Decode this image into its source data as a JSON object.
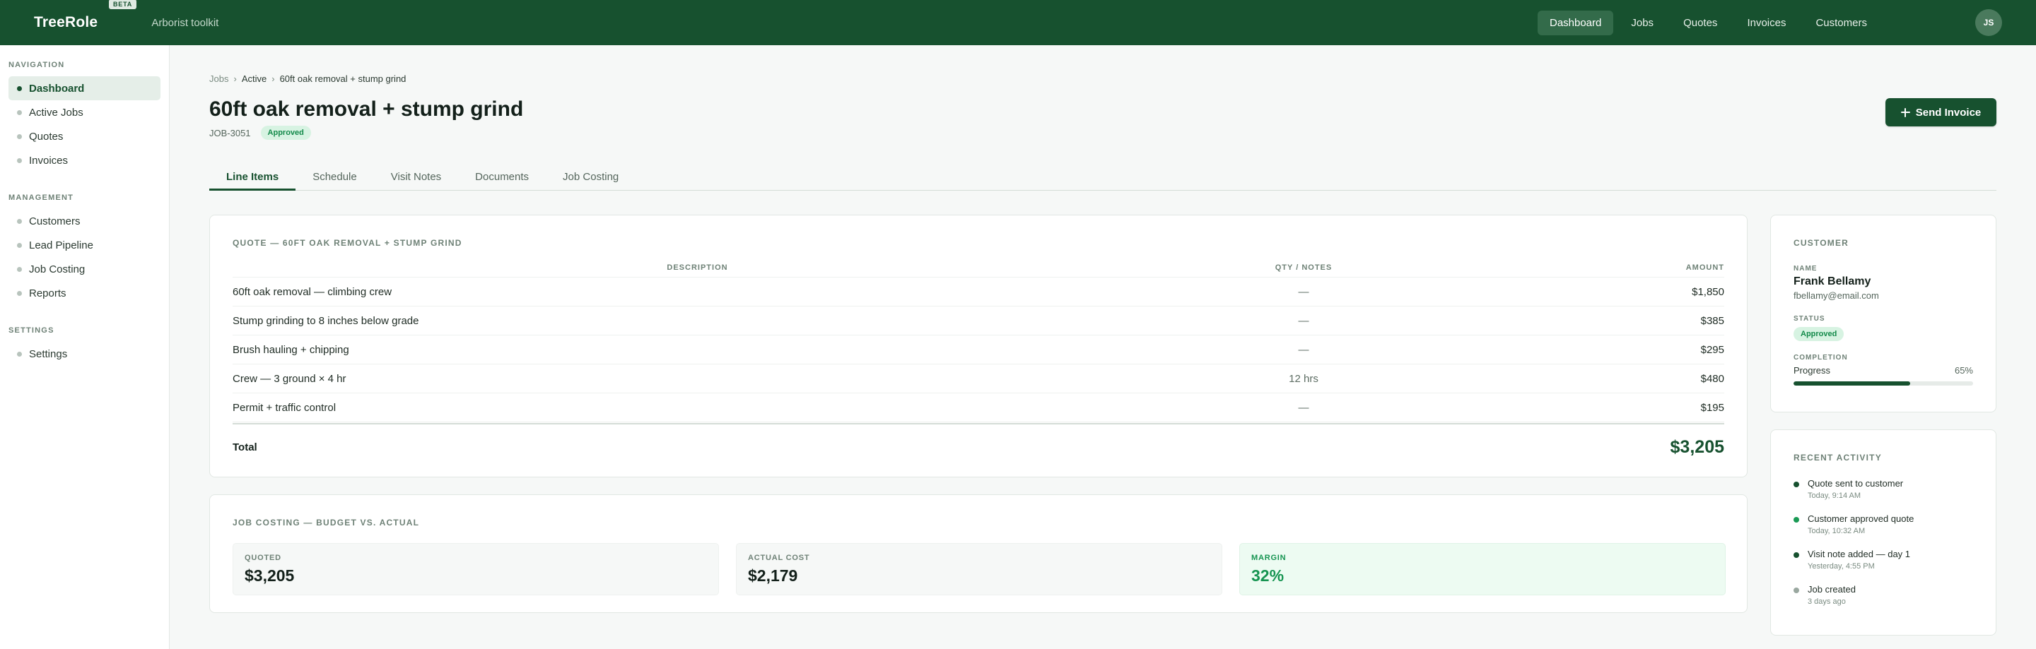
{
  "app": {
    "brand": "TreeRole",
    "beta_label": "BETA",
    "subtitle": "Arborist toolkit",
    "avatar_initials": "JS"
  },
  "topnav": {
    "items": [
      "Dashboard",
      "Jobs",
      "Quotes",
      "Invoices",
      "Customers"
    ],
    "active": "Dashboard"
  },
  "sidebar": {
    "sections": [
      {
        "title": "NAVIGATION",
        "items": [
          "Dashboard",
          "Active Jobs",
          "Quotes",
          "Invoices"
        ]
      },
      {
        "title": "MANAGEMENT",
        "items": [
          "Customers",
          "Lead Pipeline",
          "Job Costing",
          "Reports"
        ]
      },
      {
        "title": "SETTINGS",
        "items": [
          "Settings"
        ]
      }
    ],
    "active": "Dashboard"
  },
  "breadcrumb": [
    "Jobs",
    "Active",
    "60ft oak removal + stump grind"
  ],
  "breadcrumb_sep": "›",
  "job": {
    "title": "60ft oak removal + stump grind",
    "id": "JOB-3051",
    "status": "Approved"
  },
  "actions": {
    "send_invoice_label": "Send Invoice"
  },
  "tabs": {
    "items": [
      "Line Items",
      "Schedule",
      "Visit Notes",
      "Documents",
      "Job Costing"
    ],
    "active": "Line Items"
  },
  "quote": {
    "title": "QUOTE — 60FT OAK REMOVAL + STUMP GRIND",
    "columns": [
      "DESCRIPTION",
      "QTY / NOTES",
      "AMOUNT"
    ],
    "rows": [
      {
        "description": "60ft oak removal — climbing crew",
        "qty": "—",
        "amount": "$1,850"
      },
      {
        "description": "Stump grinding to 8 inches below grade",
        "qty": "—",
        "amount": "$385"
      },
      {
        "description": "Brush hauling + chipping",
        "qty": "—",
        "amount": "$295"
      },
      {
        "description": "Crew — 3 ground × 4 hr",
        "qty": "12 hrs",
        "amount": "$480"
      },
      {
        "description": "Permit + traffic control",
        "qty": "—",
        "amount": "$195"
      }
    ],
    "total_label": "Total",
    "total_amount": "$3,205"
  },
  "costing": {
    "title": "JOB COSTING — BUDGET VS. ACTUAL",
    "quoted_label": "QUOTED",
    "quoted_value": "$3,205",
    "actual_label": "ACTUAL COST",
    "actual_value": "$2,179",
    "margin_label": "MARGIN",
    "margin_value": "32%"
  },
  "customer": {
    "title": "CUSTOMER",
    "name_label": "NAME",
    "name": "Frank Bellamy",
    "email": "fbellamy@email.com",
    "status_label": "STATUS",
    "status": "Approved",
    "completion_label": "COMPLETION",
    "progress_label": "Progress",
    "progress_text": "65%",
    "progress_value": 0.65
  },
  "activity": {
    "title": "RECENT ACTIVITY",
    "items": [
      {
        "text": "Quote sent to customer",
        "time": "Today, 9:14 AM",
        "color": "#17512f"
      },
      {
        "text": "Customer approved quote",
        "time": "Today, 10:32 AM",
        "color": "#1a9a55"
      },
      {
        "text": "Visit note added — day 1",
        "time": "Yesterday, 4:55 PM",
        "color": "#17512f"
      },
      {
        "text": "Job created",
        "time": "3 days ago",
        "color": "#9aa8a0"
      }
    ]
  },
  "colors": {
    "brand": "#17512f",
    "success": "#169451",
    "badge_bg": "#d7f3e2"
  }
}
